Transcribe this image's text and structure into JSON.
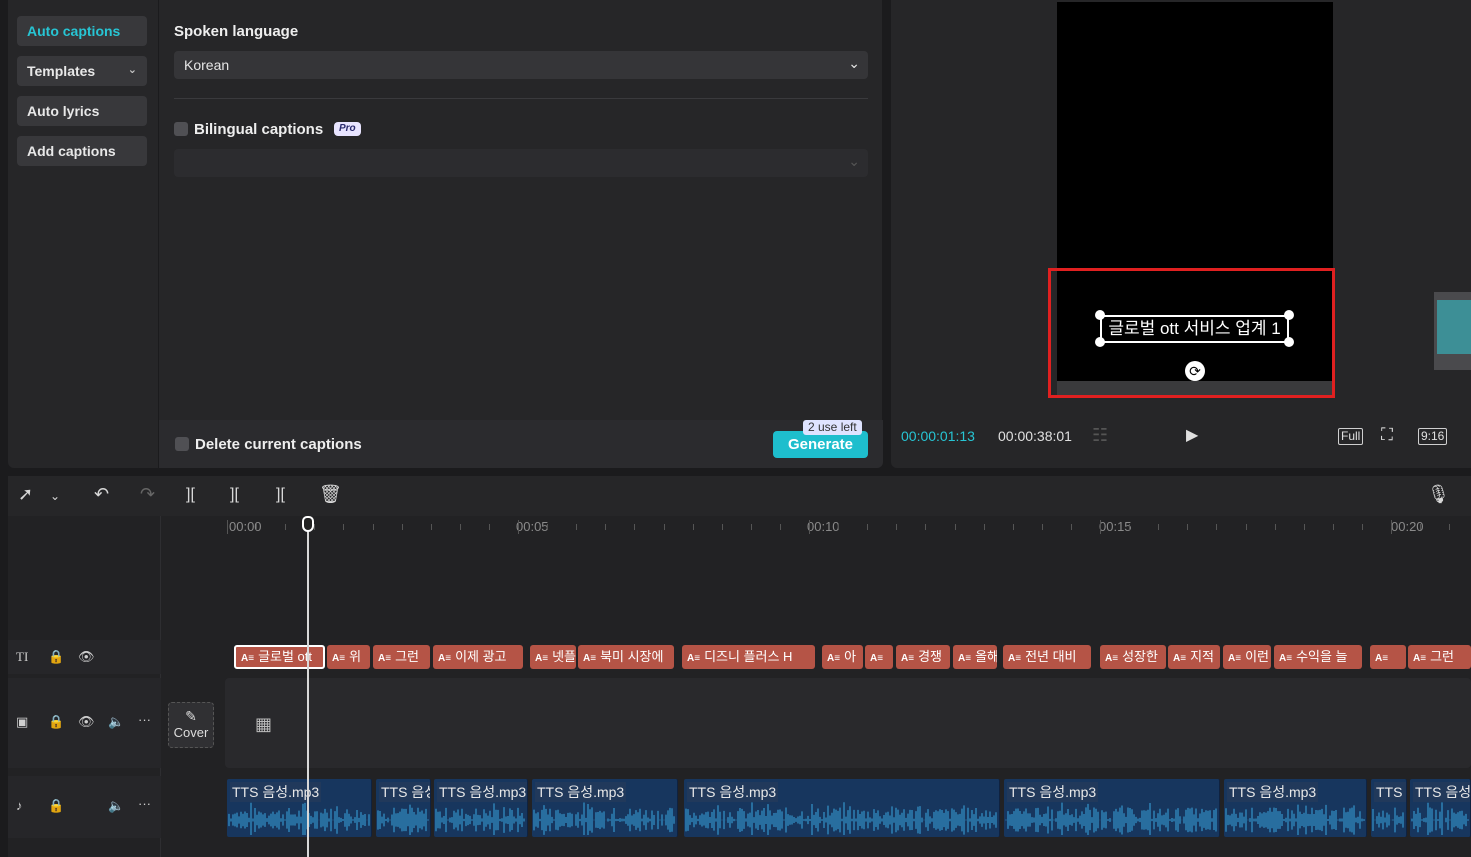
{
  "sidebar": {
    "items": [
      {
        "label": "Auto captions"
      },
      {
        "label": "Templates"
      },
      {
        "label": "Auto lyrics"
      },
      {
        "label": "Add captions"
      }
    ]
  },
  "captions_panel": {
    "spoken_language_label": "Spoken language",
    "spoken_language_value": "Korean",
    "bilingual_label": "Bilingual captions",
    "pro_badge": "Pro",
    "delete_label": "Delete current captions",
    "uses_left": "2 use left",
    "generate_label": "Generate"
  },
  "player": {
    "caption_text": "글로벌 ott 서비스 업계 1",
    "current_time": "00:00:01:13",
    "total_time": "00:00:38:01",
    "full_label": "Full",
    "ratio_label": "9:16"
  },
  "timeline": {
    "ruler_labels": [
      "00:00",
      "00:05",
      "00:10",
      "00:15",
      "00:20"
    ],
    "text_clips": [
      "글로벌 ott",
      "위",
      "그런",
      "이제 광고",
      "넷플",
      "북미 시장에",
      "디즈니 플러스 H",
      "아",
      "",
      "경쟁",
      "올해",
      "전년 대비",
      "성장한",
      "지적",
      "이런",
      "수익을 늘",
      "",
      "그런"
    ],
    "cover_label": "Cover",
    "audio_clips": [
      "TTS 음성.mp3",
      "TTS 음성",
      "TTS 음성.mp3",
      "TTS 음성.mp3",
      "TTS 음성.mp3",
      "TTS 음성.mp3",
      "TTS 음성.mp3",
      "TTS 음",
      "TTS 음성"
    ]
  },
  "colors": {
    "accent": "#1ebecd",
    "text_clip": "#b55446",
    "audio_clip": "#17365e",
    "highlight": "#e02020"
  }
}
